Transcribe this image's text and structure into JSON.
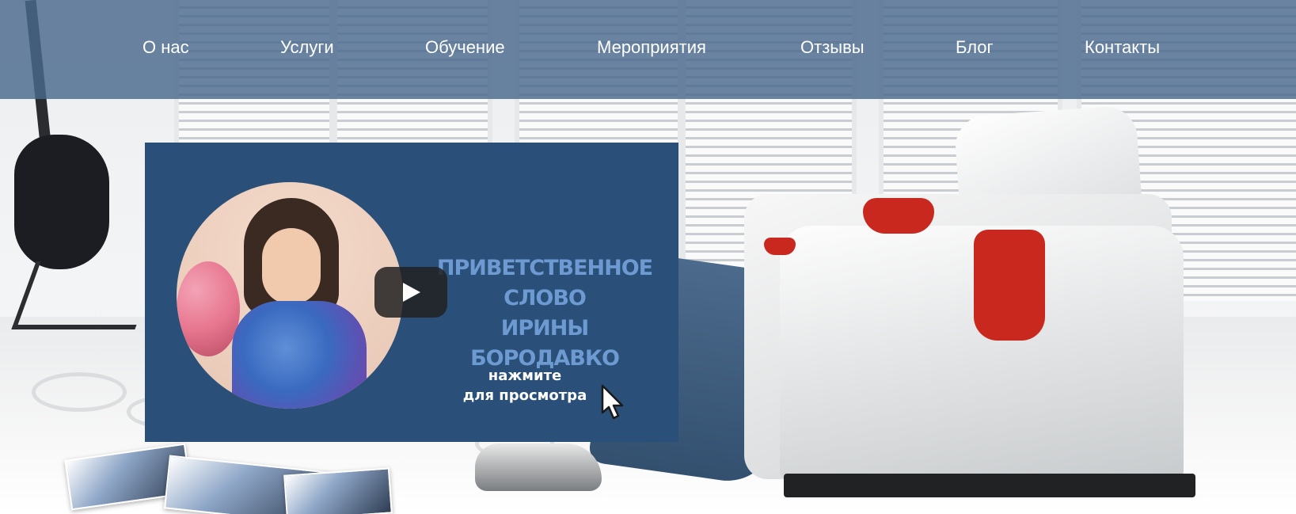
{
  "nav": {
    "items": [
      {
        "label": "О нас"
      },
      {
        "label": "Услуги"
      },
      {
        "label": "Обучение"
      },
      {
        "label": "Мероприятия"
      },
      {
        "label": "Отзывы"
      },
      {
        "label": "Блог"
      },
      {
        "label": "Контакты"
      }
    ]
  },
  "video": {
    "title_line1": "ПРИВЕТСТВЕННОЕ СЛОВО",
    "title_line2": "ИРИНЫ БОРОДАВКО",
    "cta_line1": "нажмите",
    "cta_line2": "для просмотра",
    "play_icon": "play-icon",
    "cursor_icon": "cursor-arrow-icon"
  },
  "colors": {
    "navbar": "#49698c",
    "video_bg": "#2a5079",
    "video_title": "#6e9ad2",
    "play_button": "#212121"
  }
}
